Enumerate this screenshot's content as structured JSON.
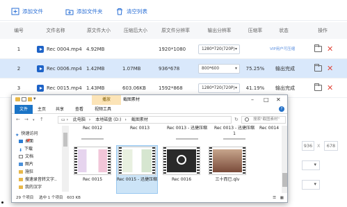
{
  "toolbar": {
    "add_file": "添加文件",
    "add_folder": "添加文件夹",
    "clear_list": "清空列表"
  },
  "table": {
    "headers": [
      "编号",
      "文件名称",
      "原文件大小",
      "压缩后大小",
      "原文件分辨率",
      "输出分辨率",
      "压缩率",
      "状态",
      "操作"
    ],
    "rows": [
      {
        "num": "1",
        "name": "Rec 0004.mp4",
        "orig_size": "4.92MB",
        "after_size": "",
        "orig_res": "1920*1080",
        "out_res": "1280*720(720P)",
        "ratio": "",
        "status": "VIP用户可压缩",
        "selected": false
      },
      {
        "num": "2",
        "name": "Rec 0006.mp4",
        "orig_size": "1.42MB",
        "after_size": "1.07MB",
        "orig_res": "936*678",
        "out_res": "800*600",
        "ratio": "75.25%",
        "status": "输出完成",
        "selected": true
      },
      {
        "num": "3",
        "name": "Rec 0015.mp4",
        "orig_size": "1.43MB",
        "after_size": "603.06KB",
        "orig_res": "1592*868",
        "out_res": "1280*720(720P)",
        "ratio": "41.19%",
        "status": "输出完成",
        "selected": false
      }
    ]
  },
  "background": {
    "res_w": "936",
    "res_x": "X",
    "res_h": "678"
  },
  "explorer": {
    "play_tab": "播放",
    "title": "截图素材",
    "ribbon": [
      "文件",
      "主页",
      "共享",
      "查看",
      "视频工具"
    ],
    "address": [
      "此电脑",
      "本地磁盘 (D:)",
      "截图素材"
    ],
    "search_placeholder": "搜索\"截图素材\"",
    "nav": {
      "quick_access": "快速访问",
      "items": [
        "桌面",
        "下载",
        "文档",
        "图片",
        "施狂",
        "搜速录音转文字..",
        "我的汉字"
      ]
    },
    "top_files": [
      "Rec 0012",
      "Rec 0013",
      "Rec 0013 - 迅捷压缩",
      "Rec 0013 - 迅捷压缩1",
      "Rec 0014"
    ],
    "files": [
      {
        "name": "Rec 0015",
        "selected": false
      },
      {
        "name": "Rec 0015 - 迅捷压缩",
        "selected": true
      },
      {
        "name": "Rec 0016",
        "selected": false
      },
      {
        "name": "三十而已.qlv",
        "selected": false
      }
    ],
    "status": {
      "count": "29 个项目",
      "selected": "选中 1 个项目",
      "size": "603 KB"
    }
  },
  "colors": {
    "accent": "#2a6fd6",
    "selected_row": "#d9e8fb",
    "delete": "#e0463b",
    "play_icon": "#1e63c7",
    "file_tab": "#1b74c6"
  }
}
